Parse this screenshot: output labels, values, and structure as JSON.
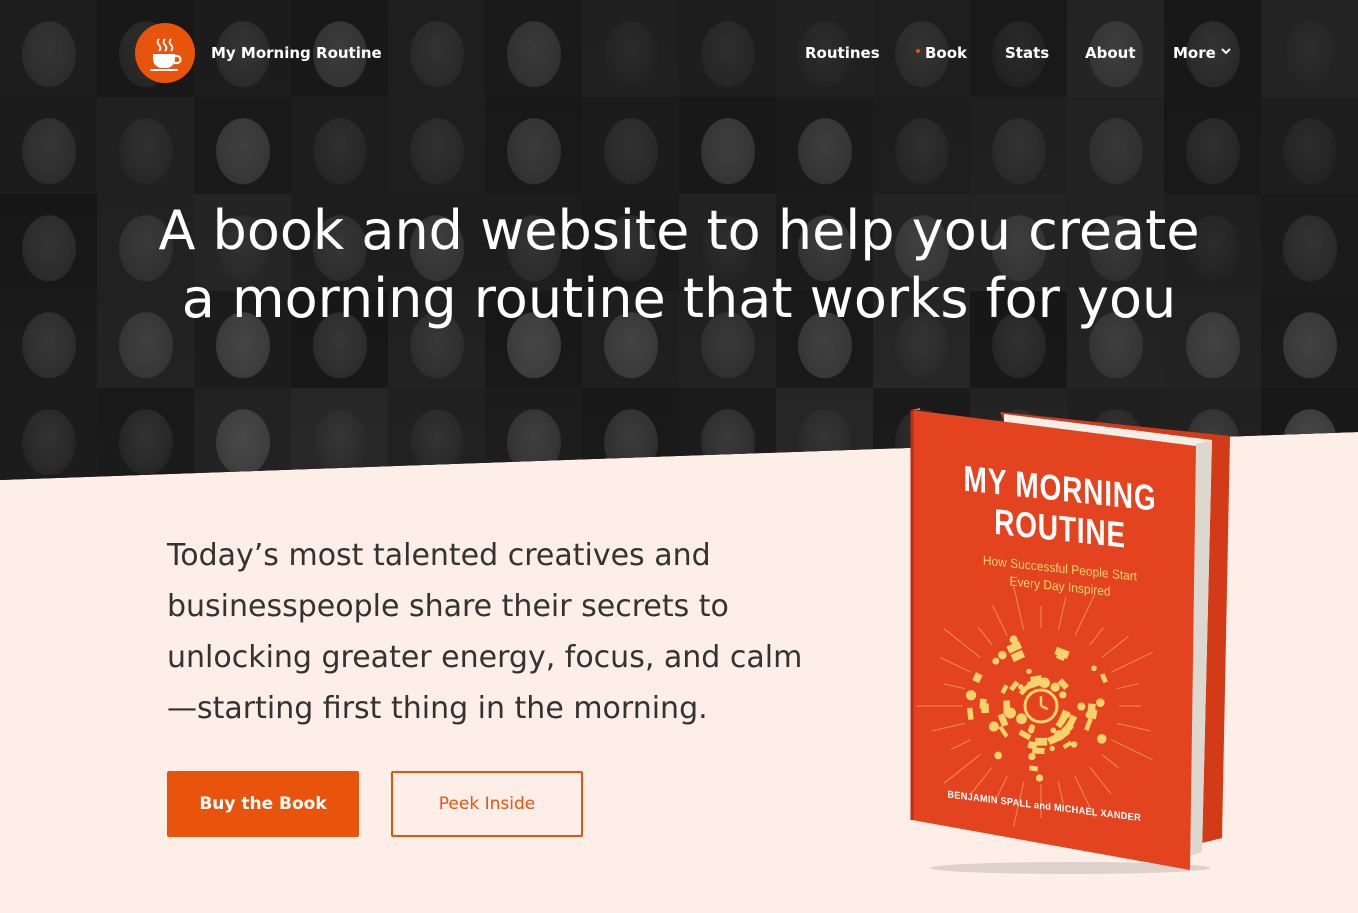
{
  "brand": {
    "name": "My Morning Routine"
  },
  "nav": {
    "items": [
      {
        "label": "Routines"
      },
      {
        "label": "Book",
        "active": true
      },
      {
        "label": "Stats"
      },
      {
        "label": "About"
      },
      {
        "label": "More",
        "has_dropdown": true
      }
    ]
  },
  "hero": {
    "headline_line1": "A book and website to help you create",
    "headline_line2": "a morning routine that works for you"
  },
  "intro": {
    "text": "Today’s most talented creatives and businesspeople share their secrets to unlocking greater energy, focus, and calm—starting first thing in the morning."
  },
  "actions": {
    "buy_label": "Buy the Book",
    "peek_label": "Peek Inside"
  },
  "book": {
    "title_line1": "MY MORNING",
    "title_line2": "ROUTINE",
    "subtitle_line1": "How Successful People Start",
    "subtitle_line2": "Every Day Inspired",
    "authors": "BENJAMIN SPALL and MICHAEL XANDER"
  },
  "colors": {
    "accent": "#e8540c",
    "hero_bg": "#1f1f1f",
    "page_bg": "#fdeee8",
    "book_cover": "#e3431f",
    "book_art": "#f6d36b"
  }
}
